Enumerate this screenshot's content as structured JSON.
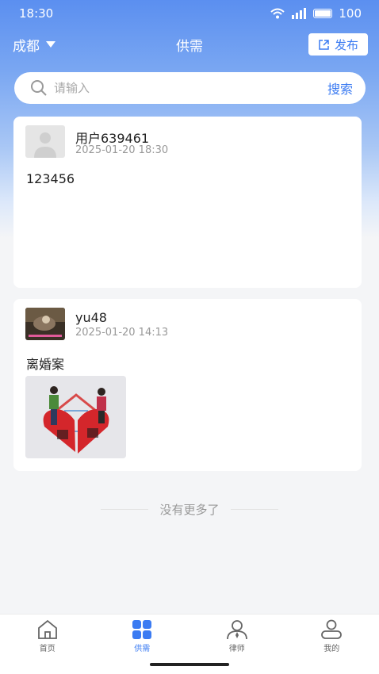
{
  "status": {
    "time": "18:30",
    "battery": "100"
  },
  "header": {
    "city": "成都",
    "title": "供需",
    "publish_label": "发布"
  },
  "search": {
    "placeholder": "请输入",
    "button_label": "搜索"
  },
  "posts": [
    {
      "username": "用户639461",
      "date": "2025-01-20 18:30",
      "content": "123456"
    },
    {
      "username": "yu48",
      "date": "2025-01-20 14:13",
      "content": "离婚案"
    }
  ],
  "footer_note": "没有更多了",
  "tabs": [
    {
      "label": "首页",
      "icon": "home-icon"
    },
    {
      "label": "供需",
      "icon": "grid-icon"
    },
    {
      "label": "律师",
      "icon": "lawyer-icon"
    },
    {
      "label": "我的",
      "icon": "profile-icon"
    }
  ],
  "colors": {
    "accent": "#3b7bf2",
    "header_gradient_top": "#5b8ff0"
  }
}
